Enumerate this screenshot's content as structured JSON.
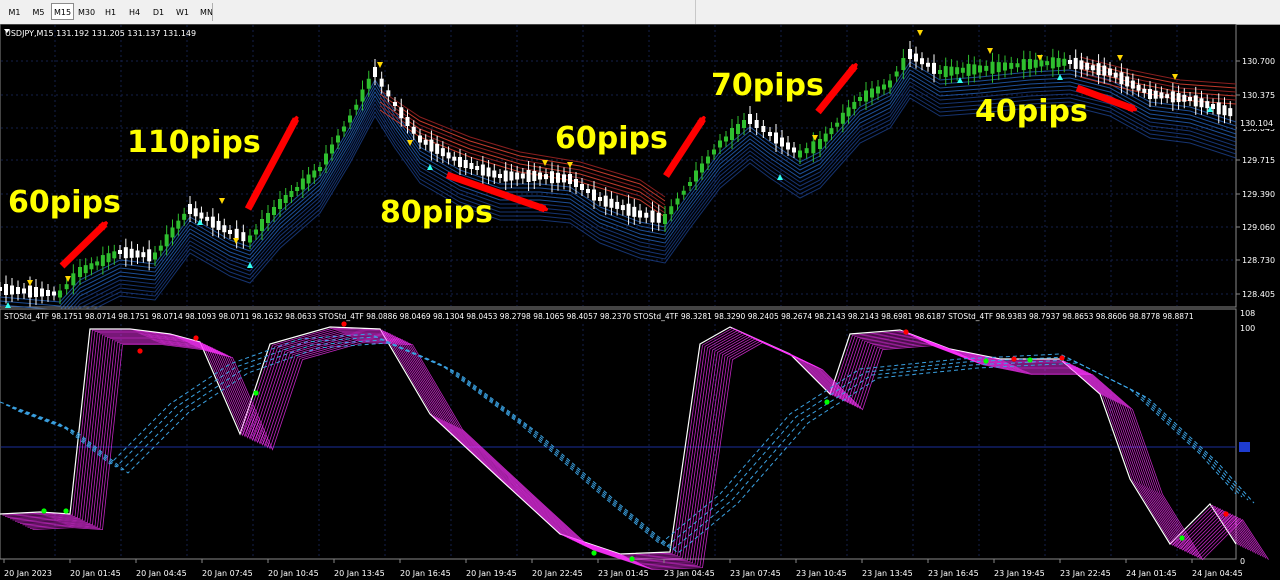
{
  "timeframes": [
    "M1",
    "M5",
    "M15",
    "M30",
    "H1",
    "H4",
    "D1",
    "W1",
    "MN"
  ],
  "active_timeframe": "M15",
  "symbol_header": "USDJPY,M15  131.192 131.205 131.137 131.149",
  "price_axis": [
    "130.700",
    "130.375",
    "130.045",
    "129.715",
    "129.390",
    "129.060",
    "128.730",
    "128.405"
  ],
  "current_price": "130.104",
  "indicator_header": "STOStd_4TF 98.1751 98.0714 98.1751 98.0714 98.1093 98.0711 98.1632 98.0633   STOStd_4TF 98.0886 98.0469 98.1304 98.0453 98.2798 98.1065 98.4057 98.2370   STOStd_4TF 98.3281 98.3290 98.2405 98.2674 98.2143 98.2143 98.6981 98.6187   STOStd_4TF 98.9383 98.7937 98.8653 98.8606 98.8778 98.8871",
  "osc_axis": {
    "top": "100",
    "mid": "108",
    "bottom": "0"
  },
  "time_axis": [
    "20 Jan 2023",
    "20 Jan 01:45",
    "20 Jan 04:45",
    "20 Jan 07:45",
    "20 Jan 10:45",
    "20 Jan 13:45",
    "20 Jan 16:45",
    "20 Jan 19:45",
    "20 Jan 22:45",
    "23 Jan 01:45",
    "23 Jan 04:45",
    "23 Jan 07:45",
    "23 Jan 10:45",
    "23 Jan 13:45",
    "23 Jan 16:45",
    "23 Jan 19:45",
    "23 Jan 22:45",
    "24 Jan 01:45",
    "24 Jan 04:45"
  ],
  "annotations": [
    "60pips",
    "110pips",
    "80pips",
    "60pips",
    "70pips",
    "40pips"
  ],
  "colors": {
    "background": "#000000",
    "bull": "#2fbf2f",
    "bear": "#ffffff",
    "annotation": "#ffff00",
    "arrow": "#ff0000",
    "uptrend_band": "#3a8cff",
    "downtrend_band": "#c0392b",
    "stoch": "#ff33ff"
  }
}
